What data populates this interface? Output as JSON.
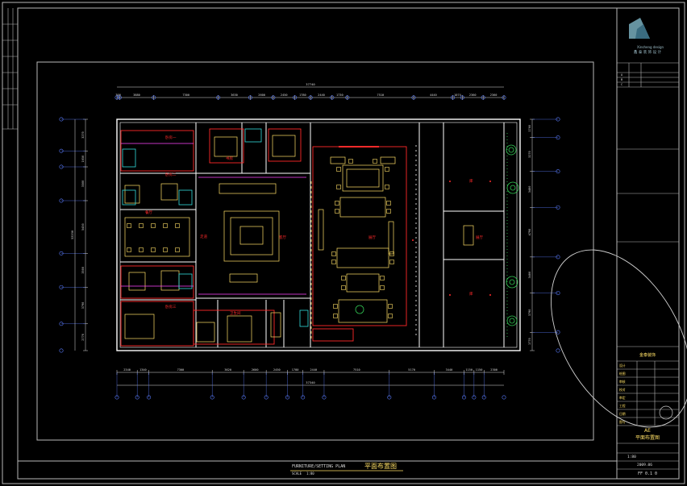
{
  "colors": {
    "background": "#000000",
    "frame": "#b8b8b8",
    "wall": "#ffffff",
    "furniture": "#ffe066",
    "red": "#ff2a2a",
    "cyan": "#33dddd",
    "magenta": "#ff44ff",
    "dimension": "#5a7cff",
    "green": "#33cc55",
    "text_yellow": "#ffe066"
  },
  "drawing": {
    "title_cn": "平面布置图",
    "title_en": "FURNITURE/SETTING PLAN",
    "scale_label": "SCALE",
    "scale_value": "1:80"
  },
  "dimensions": {
    "top_total": "37740",
    "top_segments": [
      "300",
      "3880",
      "7300",
      "3630",
      "2600",
      "2450",
      "1780",
      "2440",
      "1730",
      "7510",
      "4440",
      "1074",
      "2360",
      "2360"
    ],
    "bottom_total": "37340",
    "bottom_segments": [
      "2340",
      "1340",
      "7300",
      "3620",
      "2600",
      "2450",
      "1780",
      "2440",
      "7510",
      "5170",
      "3440",
      "1150",
      "1150",
      "2300"
    ],
    "left_total": "32230",
    "left_segments": [
      "3270",
      "1650",
      "3500",
      "5450",
      "3500",
      "3790",
      "2770"
    ],
    "right_segments": [
      "1760",
      "3270",
      "3480",
      "4790",
      "3480",
      "3790",
      "1770"
    ]
  },
  "rooms": [
    {
      "id": "room-staff-1",
      "label": "卧房一"
    },
    {
      "id": "room-staff-2",
      "label": "卧房二"
    },
    {
      "id": "room-staff-3",
      "label": "卧房三"
    },
    {
      "id": "room-dining",
      "label": "餐厅"
    },
    {
      "id": "room-corridor",
      "label": "走道"
    },
    {
      "id": "room-living",
      "label": "客厅"
    },
    {
      "id": "room-study",
      "label": "书房"
    },
    {
      "id": "room-bath",
      "label": "卫生间"
    },
    {
      "id": "room-hall",
      "label": "展厅"
    },
    {
      "id": "room-side-1",
      "label": "库"
    },
    {
      "id": "room-side-2",
      "label": "展厅"
    },
    {
      "id": "room-side-3",
      "label": "库"
    }
  ],
  "title_block": {
    "logo_caption": "鑫 泰 装 饰 设 计",
    "project_label": "AE",
    "sheet_name": "平面布置图",
    "company": "金泰装饰",
    "revision_rows": [
      "A",
      "B",
      "C"
    ],
    "fields": [
      "设计",
      "绘图",
      "审核",
      "校对",
      "审定",
      "工程",
      "日期",
      "图号"
    ],
    "sheet_no": "FF 0.1 0",
    "date": "2009.06",
    "scale": "1:80"
  }
}
